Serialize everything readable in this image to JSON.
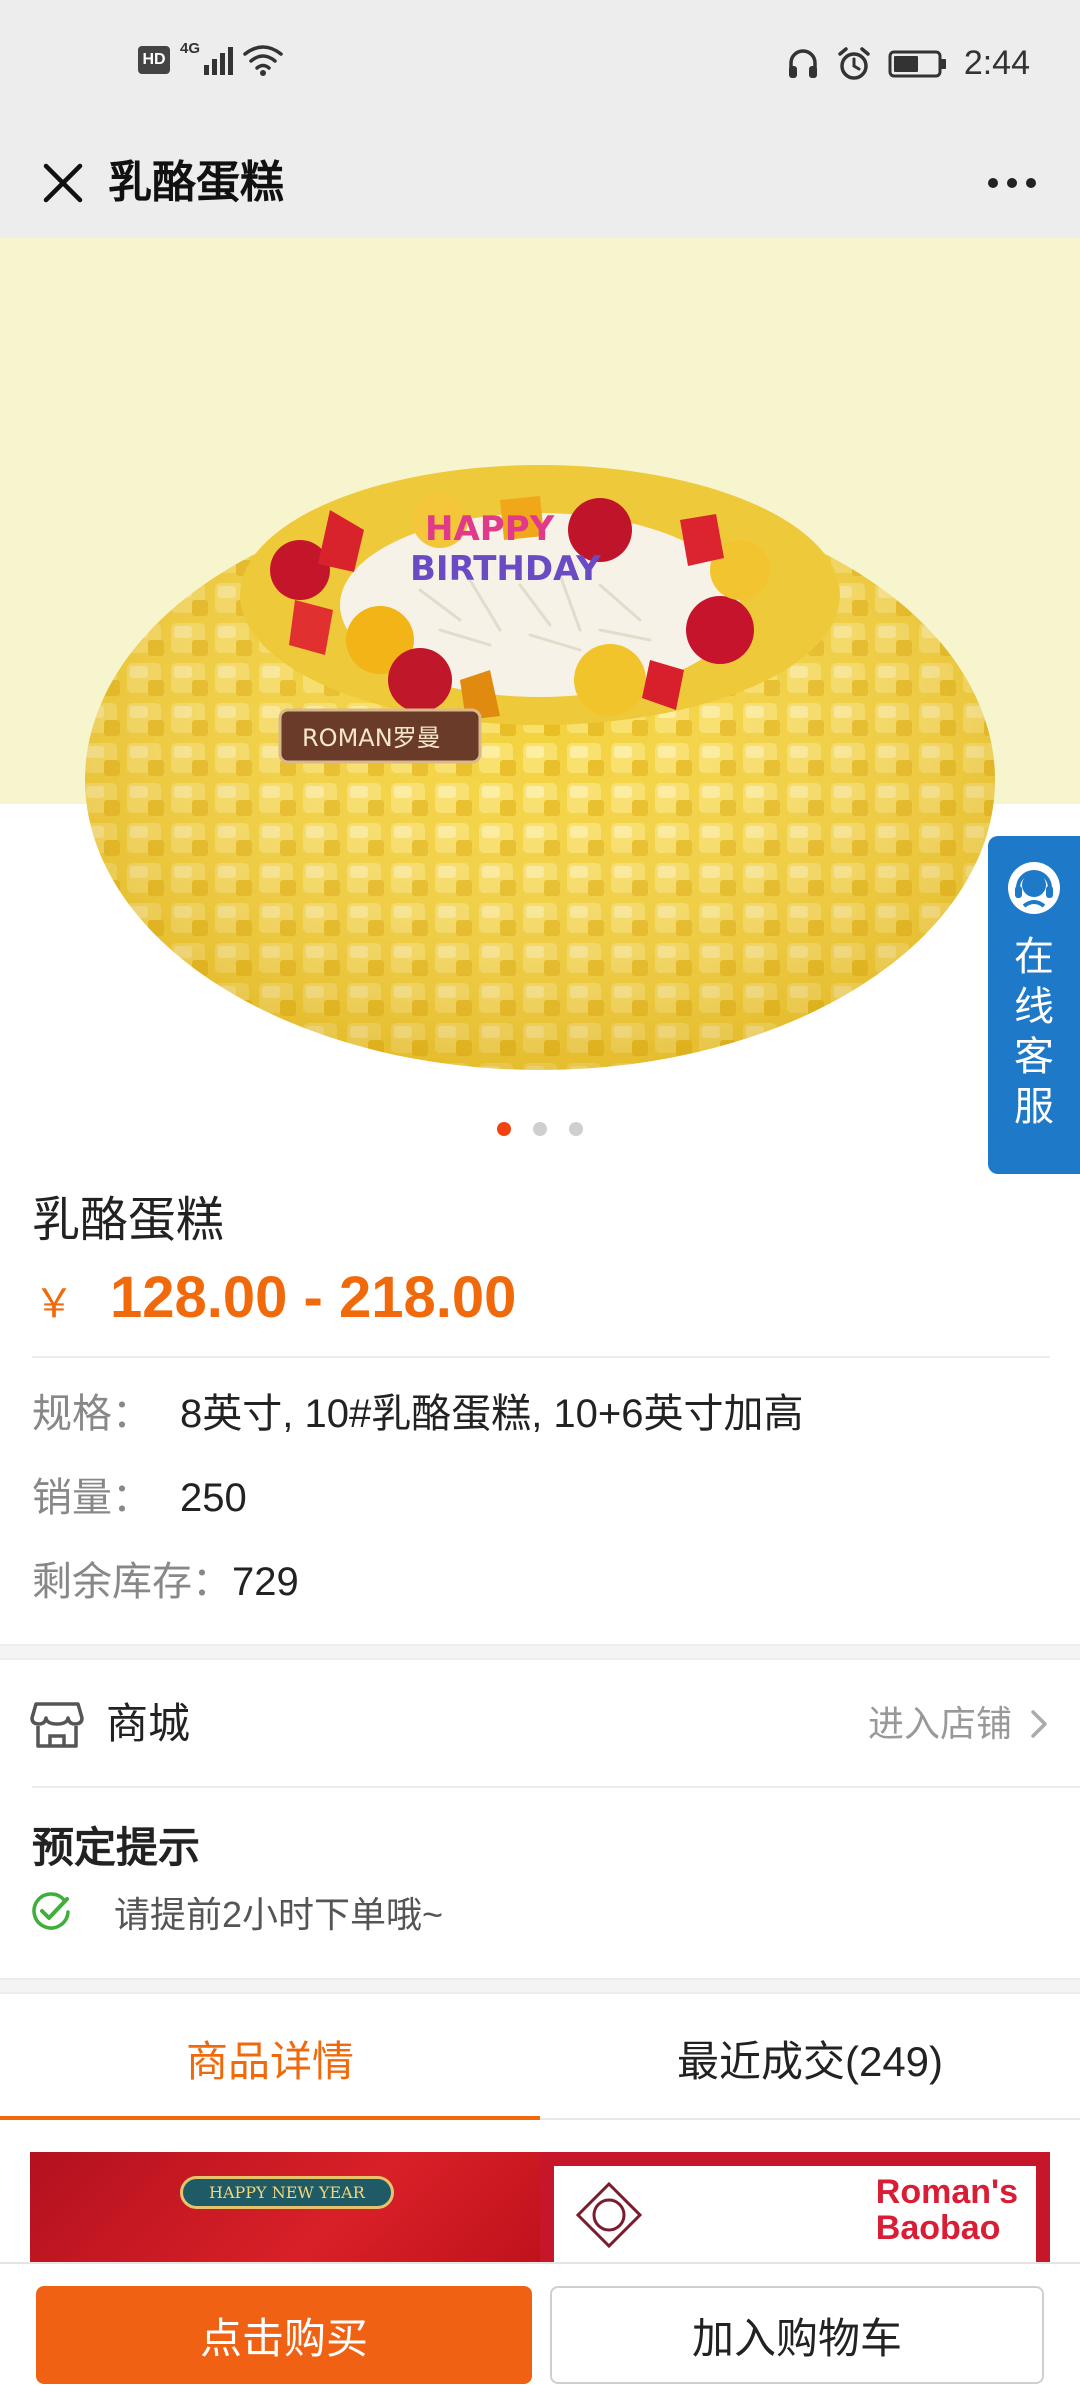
{
  "status_bar": {
    "hd": "HD",
    "network": "4G",
    "time": "2:44",
    "icons": [
      "signal-icon",
      "wifi-icon",
      "headset-icon",
      "alarm-icon",
      "battery-icon"
    ]
  },
  "nav": {
    "title": "乳酪蛋糕",
    "close_icon": "close-icon",
    "more_icon": "more-icon"
  },
  "hero": {
    "slide_count": 3,
    "active_index": 0,
    "cake_topper": "HAPPY BIRTHDAY",
    "brand_plaque": "ROMAN罗曼",
    "colors": {
      "background": "#f7f5cd",
      "active_dot": "#f2420f"
    }
  },
  "service": {
    "label": "在线客服",
    "chars": [
      "在",
      "线",
      "客",
      "服"
    ],
    "color": "#1e79c8"
  },
  "product": {
    "name": "乳酪蛋糕",
    "currency": "￥",
    "price_range": "128.00 - 218.00",
    "spec_label": "规格：",
    "spec_value": "8英寸, 10#乳酪蛋糕, 10+6英寸加高",
    "sales_label": "销量：",
    "sales_value": "250",
    "stock_label": "剩余库存：",
    "stock_value": "729",
    "accent_color": "#f06a0c"
  },
  "shop": {
    "name": "商城",
    "enter_label": "进入店铺"
  },
  "notice": {
    "title": "预定提示",
    "text": "请提前2小时下单哦~"
  },
  "tabs": [
    {
      "label": "商品详情",
      "active": true
    },
    {
      "label": "最近成交(249)",
      "active": false
    }
  ],
  "detail_preview": {
    "banner": "HAPPY NEW YEAR",
    "brand_line1": "Roman's",
    "brand_line2": "Baobao"
  },
  "actions": {
    "buy_label": "点击购买",
    "cart_label": "加入购物车",
    "buy_color": "#f06113"
  }
}
